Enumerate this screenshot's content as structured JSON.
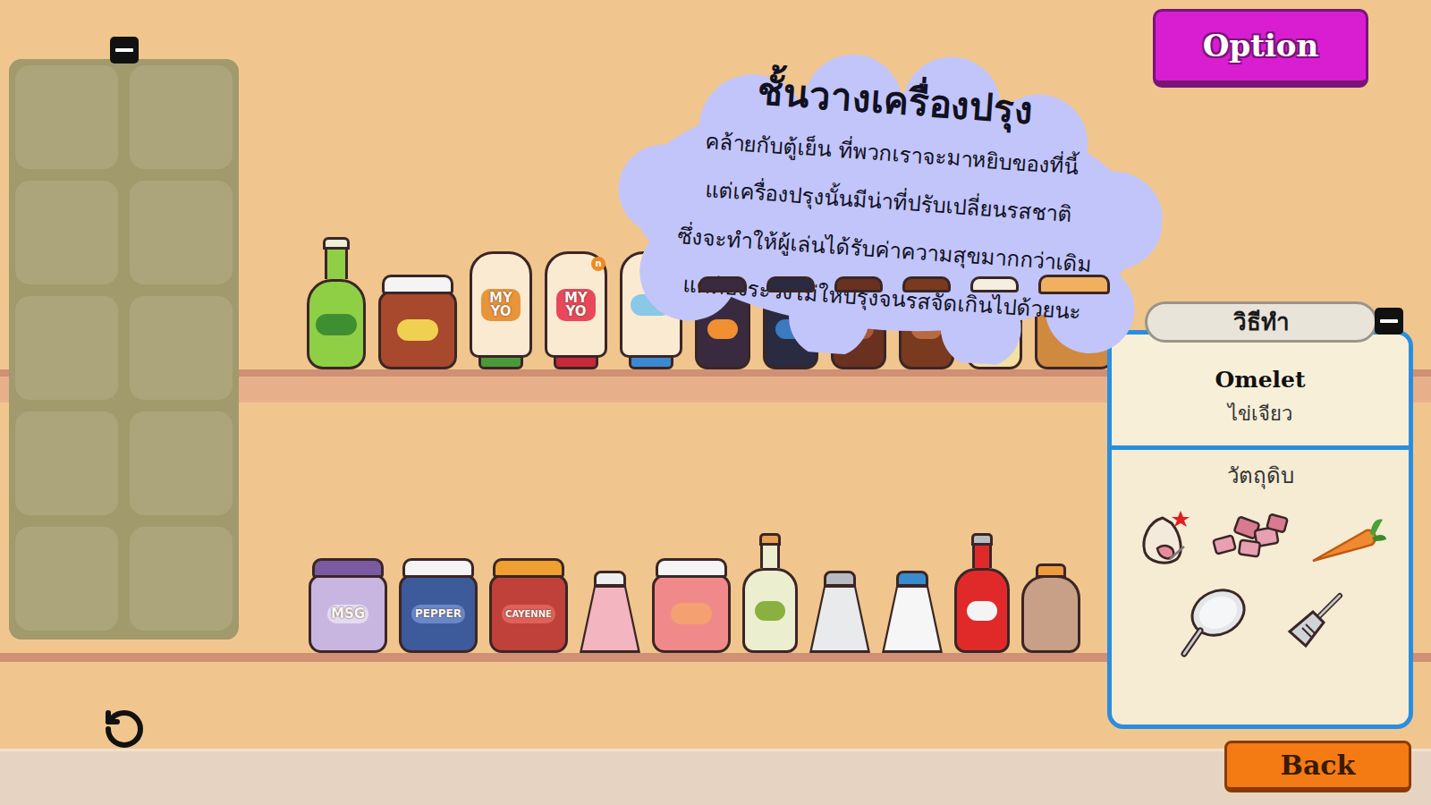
{
  "option_button": "Option",
  "back_button": "Back",
  "inventory": {
    "slots": [
      {
        "empty": true
      },
      {
        "empty": true
      },
      {
        "empty": true
      },
      {
        "empty": true
      },
      {
        "empty": true
      },
      {
        "empty": true
      },
      {
        "empty": true
      },
      {
        "empty": true
      },
      {
        "empty": true
      },
      {
        "empty": true
      }
    ]
  },
  "tooltip": {
    "title": "ชั้นวางเครื่องปรุง",
    "lines": [
      "คล้ายกับตู้เย็น ที่พวกเราจะมาหยิบของที่นี้",
      "แต่เครื่องปรุงนั้นมีน่าที่ปรับเปลี่ยนรสชาติ",
      "ซึ่งจะทำให้ผู้เล่นได้รับค่าความสุขมากกว่าเดิม",
      "แต่ต้องระวังไม่ให้ปรุงจนรสจัดเกินไปด้วยนะ"
    ]
  },
  "recipe": {
    "header": "วิธีทำ",
    "name": "Omelet",
    "name_th": "ไข่เจียว",
    "ingredients_label": "วัตถุดิบ",
    "ingredients": [
      {
        "kind": "garlic",
        "marked": true
      },
      {
        "kind": "meat",
        "marked": false
      },
      {
        "kind": "carrot",
        "marked": false
      },
      {
        "kind": "pan",
        "marked": false
      },
      {
        "kind": "spatula",
        "marked": false
      }
    ]
  },
  "shelves": [
    {
      "items": [
        {
          "kind": "bottle",
          "color": "#8fcf45",
          "lid_color": "#e8f0d8",
          "label_color": "#3f8f32"
        },
        {
          "kind": "jar",
          "color": "#a8482c",
          "lid_color": "#f4f4f4",
          "label_color": "#f0d050"
        },
        {
          "kind": "squeeze",
          "color": "#fbead2",
          "lid_color": "#4a9a3a",
          "label_color": "#e8943a",
          "label": [
            "MY",
            "YO"
          ]
        },
        {
          "kind": "squeeze",
          "color": "#fbead2",
          "lid_color": "#c8283a",
          "label_color": "#e8485a",
          "label": [
            "MY",
            "YO"
          ],
          "badge": "n"
        },
        {
          "kind": "squeeze",
          "color": "#fbead2",
          "lid_color": "#3a8ad0",
          "label_color": "#8ac8e8"
        },
        {
          "kind": "small_jar",
          "color": "#3a2a40",
          "lid_color": "#3a2a40",
          "label_color": "#f09030"
        },
        {
          "kind": "small_jar",
          "color": "#2a2a40",
          "lid_color": "#2a2a40",
          "label_color": "#3a7ac0"
        },
        {
          "kind": "small_jar",
          "color": "#6a3020",
          "lid_color": "#6a3020",
          "label_color": "#a85a3a"
        },
        {
          "kind": "small_jar",
          "color": "#7a3a20",
          "lid_color": "#7a3a20",
          "label_color": "#b86a40"
        },
        {
          "kind": "small_jar",
          "color": "#f4e0a0",
          "lid_color": "#f4f0e0",
          "label_color": "#f0c040"
        },
        {
          "kind": "jar",
          "color": "#d08a40",
          "lid_color": "#f0b060",
          "label_color": "#e8a858"
        }
      ]
    },
    {
      "items": [
        {
          "kind": "jar",
          "color": "#c9b6e0",
          "lid_color": "#7a5aa0",
          "label_color": "#e6dcf2",
          "label": [
            "MSG"
          ]
        },
        {
          "kind": "jar",
          "color": "#3d5a9a",
          "lid_color": "#f4f4f4",
          "label_color": "#6a88c8",
          "label": [
            "PEPPER"
          ]
        },
        {
          "kind": "jar",
          "color": "#c0403a",
          "lid_color": "#f0a030",
          "label_color": "#e0605a",
          "label": [
            "CAYENNE"
          ]
        },
        {
          "kind": "shaker",
          "color": "#f3b6c0",
          "lid_color": "#eeeeee",
          "label_color": "#f3b6c0"
        },
        {
          "kind": "jar",
          "color": "#f08a8a",
          "lid_color": "#f4f4f4",
          "label_color": "#f4a070"
        },
        {
          "kind": "tall_bottle",
          "color": "#eceed0",
          "lid_color": "#e8a050",
          "label_color": "#8ab040"
        },
        {
          "kind": "shaker",
          "color": "#e8eaec",
          "lid_color": "#b8bcc0",
          "label_color": "#e8eaec"
        },
        {
          "kind": "shaker",
          "color": "#f6f6f6",
          "lid_color": "#3a8ad0",
          "label_color": "#f6f6f6"
        },
        {
          "kind": "tall_bottle",
          "color": "#e02a2a",
          "lid_color": "#b8bcc0",
          "label_color": "#f4f4f4"
        },
        {
          "kind": "flask",
          "color": "#c8a088",
          "lid_color": "#f09a40",
          "label_color": "#c8a088"
        }
      ]
    }
  ]
}
